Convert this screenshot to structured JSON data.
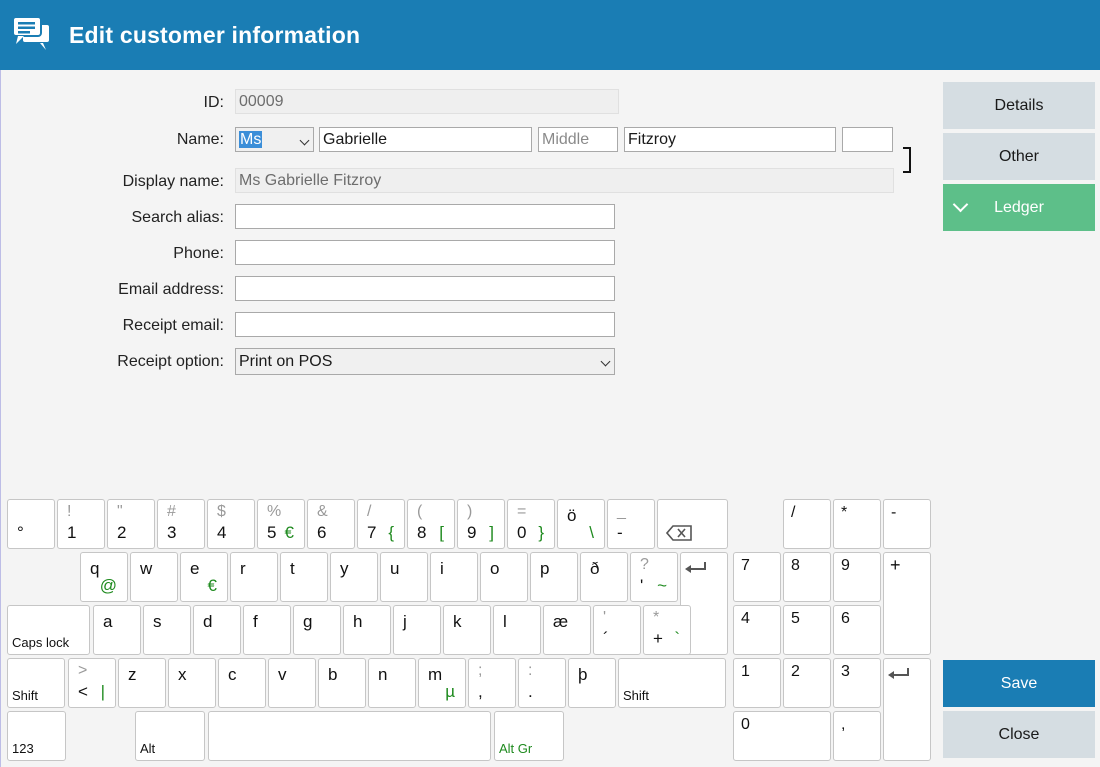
{
  "window": {
    "title": "Edit customer information",
    "accent": "#1a7db4"
  },
  "form": {
    "id_label": "ID:",
    "id_value": "00009",
    "name_label": "Name:",
    "title_value": "Ms",
    "first_name": "Gabrielle",
    "middle_placeholder": "Middle",
    "last_name": "Fitzroy",
    "suffix": "",
    "display_label": "Display name:",
    "display_value": "Ms Gabrielle Fitzroy",
    "alias_label": "Search alias:",
    "alias_value": "",
    "phone_label": "Phone:",
    "phone_value": "",
    "email_label": "Email address:",
    "email_value": "",
    "receipt_email_label": "Receipt email:",
    "receipt_email_value": "",
    "receipt_option_label": "Receipt option:",
    "receipt_option_value": "Print on POS"
  },
  "side": {
    "details": "Details",
    "other": "Other",
    "ledger": "Ledger",
    "save": "Save",
    "close": "Close"
  },
  "keyboard": {
    "row1": [
      {
        "m": "°"
      },
      {
        "s": "!",
        "m": "1"
      },
      {
        "s": "\"",
        "m": "2"
      },
      {
        "s": "#",
        "m": "3"
      },
      {
        "s": "$",
        "m": "4"
      },
      {
        "s": "%",
        "m": "5",
        "g": "€"
      },
      {
        "s": "&",
        "m": "6"
      },
      {
        "s": "/",
        "m": "7",
        "g": "{"
      },
      {
        "s": "(",
        "m": "8",
        "g": "["
      },
      {
        "s": ")",
        "m": "9",
        "g": "]"
      },
      {
        "s": "=",
        "m": "0",
        "g": "}"
      },
      {
        "t": "ö",
        "g": "\\"
      },
      {
        "s": "_",
        "m": "-"
      }
    ],
    "row2": [
      {
        "t": "q",
        "g": "@"
      },
      {
        "t": "w"
      },
      {
        "t": "e",
        "g": "€"
      },
      {
        "t": "r"
      },
      {
        "t": "t"
      },
      {
        "t": "y"
      },
      {
        "t": "u"
      },
      {
        "t": "i"
      },
      {
        "t": "o"
      },
      {
        "t": "p"
      },
      {
        "t": "ð"
      },
      {
        "s": "?",
        "m": "'",
        "g": "~"
      }
    ],
    "row3": [
      {
        "t": "a"
      },
      {
        "t": "s"
      },
      {
        "t": "d"
      },
      {
        "t": "f"
      },
      {
        "t": "g"
      },
      {
        "t": "h"
      },
      {
        "t": "j"
      },
      {
        "t": "k"
      },
      {
        "t": "l"
      },
      {
        "t": "æ"
      },
      {
        "s": "'",
        "m": "´"
      },
      {
        "s": "*",
        "m": "+",
        "g": "`"
      }
    ],
    "row4": [
      {
        "s": ">",
        "m": "<",
        "g": "|"
      },
      {
        "t": "z"
      },
      {
        "t": "x"
      },
      {
        "t": "c"
      },
      {
        "t": "v"
      },
      {
        "t": "b"
      },
      {
        "t": "n"
      },
      {
        "t": "m",
        "g": "µ"
      },
      {
        "s": ";",
        "m": ","
      },
      {
        "s": ":",
        "m": "."
      },
      {
        "t": "þ"
      }
    ],
    "caps_lock": "Caps lock",
    "shift": "Shift",
    "num_mode": "123",
    "alt": "Alt",
    "alt_gr": "Alt Gr",
    "numpad": [
      "/",
      "*",
      "-",
      "7",
      "8",
      "9",
      "+",
      "4",
      "5",
      "6",
      "1",
      "2",
      "3",
      "0",
      ","
    ]
  }
}
